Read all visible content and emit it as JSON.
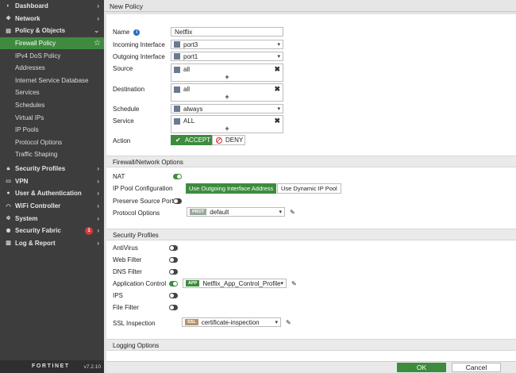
{
  "sidebar": {
    "items": [
      {
        "label": "Dashboard",
        "icon": "dashboard-icon"
      },
      {
        "label": "Network",
        "icon": "network-icon"
      },
      {
        "label": "Policy & Objects",
        "icon": "policy-icon"
      },
      {
        "label": "Firewall Policy"
      },
      {
        "label": "IPv4 DoS Policy"
      },
      {
        "label": "Addresses"
      },
      {
        "label": "Internet Service Database"
      },
      {
        "label": "Services"
      },
      {
        "label": "Schedules"
      },
      {
        "label": "Virtual IPs"
      },
      {
        "label": "IP Pools"
      },
      {
        "label": "Protocol Options"
      },
      {
        "label": "Traffic Shaping"
      },
      {
        "label": "Security Profiles",
        "icon": "lock-icon"
      },
      {
        "label": "VPN",
        "icon": "vpn-icon"
      },
      {
        "label": "User & Authentication",
        "icon": "user-icon"
      },
      {
        "label": "WiFi Controller",
        "icon": "wifi-icon"
      },
      {
        "label": "System",
        "icon": "gear-icon"
      },
      {
        "label": "Security Fabric",
        "icon": "fabric-icon",
        "badge": "1"
      },
      {
        "label": "Log & Report",
        "icon": "chart-icon"
      }
    ],
    "logo": "FORTINET",
    "version": "v7.2.10"
  },
  "header": {
    "title": "New Policy"
  },
  "form": {
    "name_label": "Name",
    "name_value": "Netflix",
    "incoming_label": "Incoming Interface",
    "incoming_value": "port3",
    "outgoing_label": "Outgoing Interface",
    "outgoing_value": "port1",
    "source_label": "Source",
    "source_value": "all",
    "destination_label": "Destination",
    "destination_value": "all",
    "schedule_label": "Schedule",
    "schedule_value": "always",
    "service_label": "Service",
    "service_value": "ALL",
    "action_label": "Action",
    "accept_label": "ACCEPT",
    "deny_label": "DENY",
    "plus": "+",
    "remove": "✖",
    "caret": "▾"
  },
  "firewall": {
    "section_title": "Firewall/Network Options",
    "nat_label": "NAT",
    "ip_pool_label": "IP Pool Configuration",
    "ip_pool_opt1": "Use Outgoing Interface Address",
    "ip_pool_opt2": "Use Dynamic IP Pool",
    "preserve_label": "Preserve Source Port",
    "protocol_label": "Protocol Options",
    "protocol_tag": "PROT",
    "protocol_value": "default"
  },
  "security": {
    "section_title": "Security Profiles",
    "antivirus_label": "AntiVirus",
    "webfilter_label": "Web Filter",
    "dnsfilter_label": "DNS Filter",
    "appcontrol_label": "Application Control",
    "app_tag": "APP",
    "app_value": "Netflix_App_Control_Profile",
    "ips_label": "IPS",
    "filefilter_label": "File Filter",
    "ssl_label": "SSL Inspection",
    "ssl_tag": "SSL",
    "ssl_value": "certificate-inspection"
  },
  "logging": {
    "section_title": "Logging Options"
  },
  "buttons": {
    "ok": "OK",
    "cancel": "Cancel"
  },
  "colors": {
    "accent": "#3d8c3d",
    "sidebar": "#3d3d3d",
    "badge": "#d43a3a"
  }
}
